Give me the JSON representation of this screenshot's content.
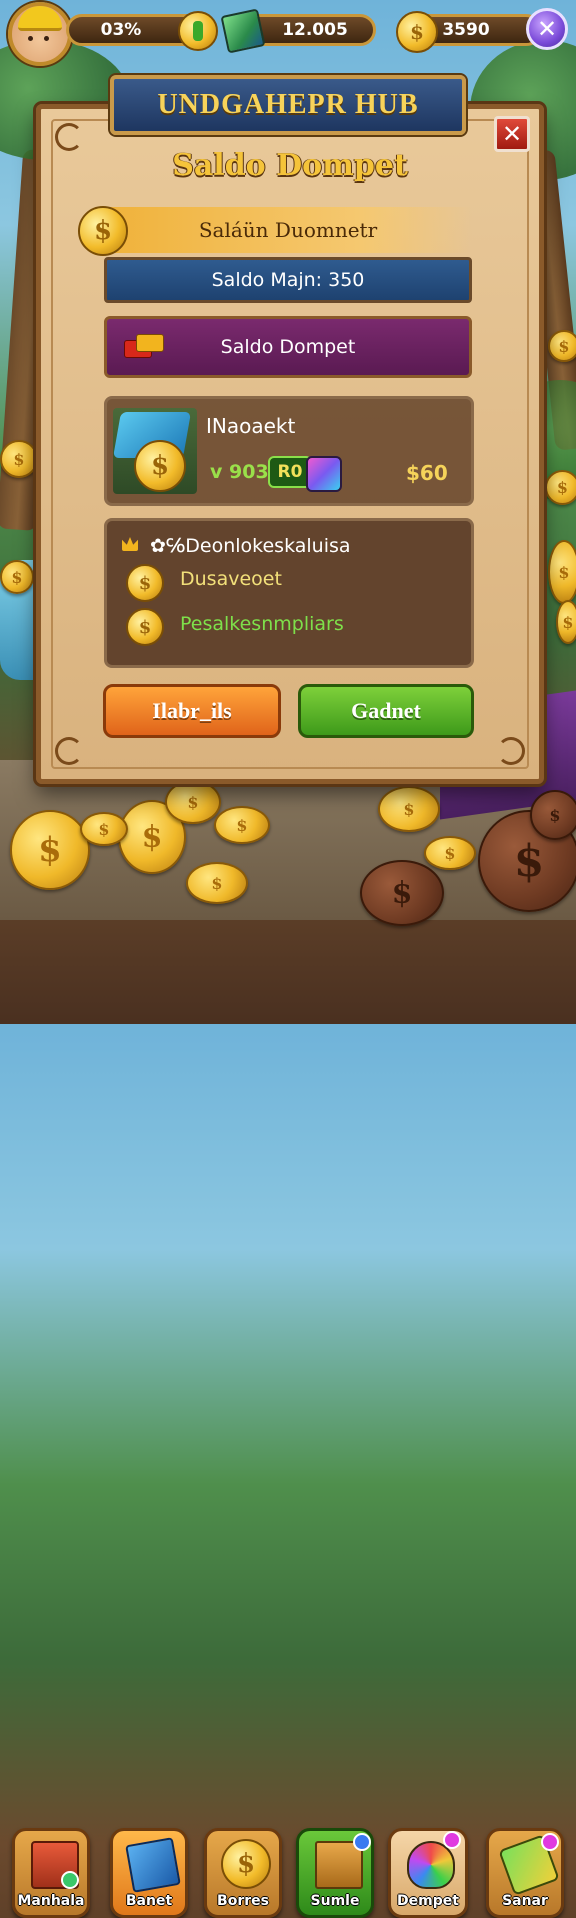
{
  "topbar": {
    "stat1_value": "03%",
    "stat2_value": "12.005",
    "stat3_value": "3590"
  },
  "hub": {
    "banner_title": "UNDGAHEPR HUB",
    "close_label": "✕",
    "panel_title": "Saldo Dompet",
    "sub_title": "Saláün Duomnetr",
    "bar_blue_text": "Saldo Majn: 350",
    "bar_purple_text": "Saldo Dompet"
  },
  "item_card": {
    "name": "INaoaekt",
    "stat_left": "ᴠ 903",
    "stat_badge": "R0",
    "price": "$60"
  },
  "details": {
    "heading": "✿℅Deonlokeskaluisa",
    "row1": "Dusaveoet",
    "row2": "Pesalkesnmpliars"
  },
  "buttons": {
    "orange_label": "Ilabr_ils",
    "green_label": "Gadnet"
  },
  "nav": [
    {
      "label": "Manhala"
    },
    {
      "label": "Banet"
    },
    {
      "label": "Borres"
    },
    {
      "label": "Sumle"
    },
    {
      "label": "Dempet"
    },
    {
      "label": "Sanar"
    }
  ],
  "colors": {
    "panel_bg": "#e9c99a",
    "title_gold": "#f5c43a",
    "bar_blue": "#2f5b8f",
    "bar_purple": "#7a2a6e",
    "button_orange": "#ffa43a",
    "button_green": "#7ed03a",
    "detail_green": "#7ee04a",
    "detail_yellow": "#f2e07a"
  },
  "icons": {
    "coin": "dollar-coin-icon",
    "gem": "green-gem-icon",
    "close": "close-icon"
  }
}
